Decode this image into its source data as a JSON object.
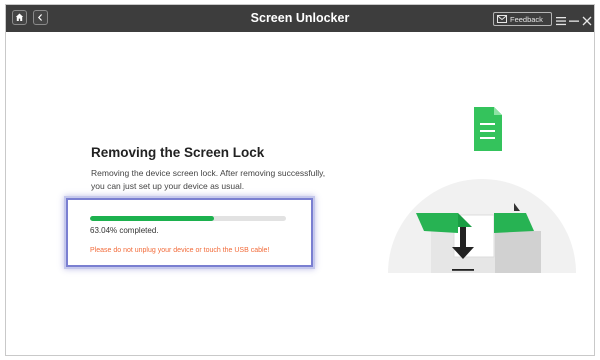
{
  "window": {
    "title": "Screen Unlocker",
    "feedback_label": "Feedback"
  },
  "main": {
    "heading": "Removing the Screen Lock",
    "description": "Removing the device screen lock. After removing successfully, you can just set up your device as usual.",
    "progress": {
      "fraction": 0.6304,
      "text": "63.04% completed.",
      "warning": "Please do not unplug your device or touch the USB cable!"
    }
  },
  "colors": {
    "titlebar": "#3d3d3d",
    "accent_green": "#1cb14e",
    "warning": "#f26b3a",
    "highlight_border": "#7a7fd1"
  },
  "icons": {
    "home": "home-icon",
    "back": "chevron-left-icon",
    "feedback": "mail-icon",
    "menu": "menu-icon",
    "minimize": "minimize-icon",
    "close": "close-icon",
    "document": "document-icon",
    "download_arrow": "download-arrow-icon"
  }
}
